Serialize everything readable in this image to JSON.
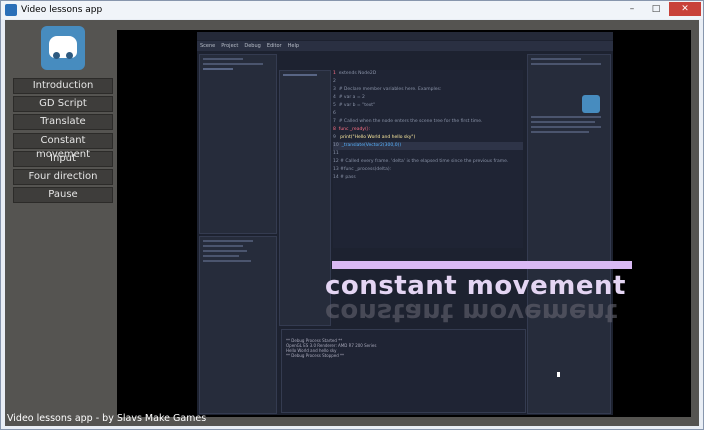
{
  "window": {
    "title": "Video lessons app",
    "controls": [
      "–",
      "□",
      "✕"
    ]
  },
  "menu": {
    "items": [
      {
        "label": "Introduction"
      },
      {
        "label": "GD Script"
      },
      {
        "label": "Translate"
      },
      {
        "label": "Constant movement"
      },
      {
        "label": "Input"
      },
      {
        "label": "Four direction"
      },
      {
        "label": "Pause"
      }
    ]
  },
  "video": {
    "editor_menus": [
      "Scene",
      "Project",
      "Debug",
      "Editor",
      "Help"
    ],
    "overlay_caption": "constant movement",
    "code_lines": [
      "extends Node2D",
      "",
      "# Declare member variables here. Examples:",
      "# var a = 2",
      "# var b = \"text\"",
      "",
      "# Called when the node enters the scene tree for the first time.",
      "func _ready():",
      "    print(\"Hello World and hello sky\")",
      "    _translate(Vector2(300,0))",
      "",
      "# Called every frame. 'delta' is the elapsed time since the previous frame.",
      "#func _process(delta):",
      "#    pass"
    ],
    "output_lines": [
      "** Debug Process Started **",
      "OpenGL ES 3.0 Renderer: AMD R7 200 Series",
      "Hello World and hello sky",
      "** Debug Process Stopped **"
    ]
  },
  "footer": {
    "text": "Video lessons app - by Slavs Make Games"
  }
}
